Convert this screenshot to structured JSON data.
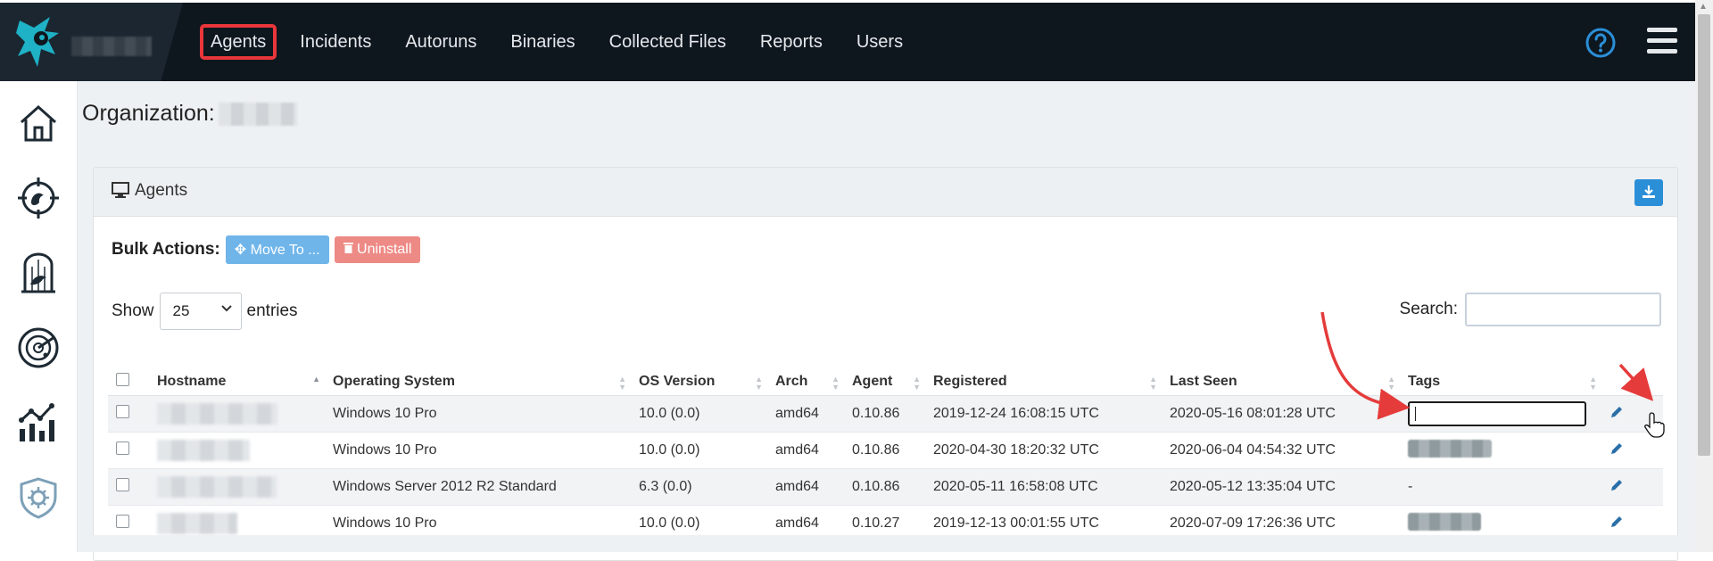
{
  "topbar": {
    "nav": [
      "Agents",
      "Incidents",
      "Autoruns",
      "Binaries",
      "Collected Files",
      "Reports",
      "Users"
    ],
    "active_nav": "Agents"
  },
  "sidebar": {
    "icons": [
      "home-icon",
      "threat-target-icon",
      "caged-bird-icon",
      "radar-icon",
      "stats-chart-icon",
      "shield-gear-icon"
    ]
  },
  "page": {
    "org_label": "Organization:"
  },
  "panel": {
    "title": "Agents",
    "bulk_label": "Bulk Actions:",
    "move_to_label": "Move To ...",
    "uninstall_label": "Uninstall",
    "show_label": "Show",
    "entries_value": "25",
    "entries_label": "entries",
    "search_label": "Search:",
    "search_value": ""
  },
  "table": {
    "columns": [
      "Hostname",
      "Operating System",
      "OS Version",
      "Arch",
      "Agent",
      "Registered",
      "Last Seen",
      "Tags"
    ],
    "rows": [
      {
        "os": "Windows 10 Pro",
        "os_version": "10.0 (0.0)",
        "arch": "amd64",
        "agent": "0.10.86",
        "registered": "2019-12-24 16:08:15 UTC",
        "last_seen": "2020-05-16 08:01:28 UTC",
        "tag": "editing"
      },
      {
        "os": "Windows 10 Pro",
        "os_version": "10.0 (0.0)",
        "arch": "amd64",
        "agent": "0.10.86",
        "registered": "2020-04-30 18:20:32 UTC",
        "last_seen": "2020-06-04 04:54:32 UTC",
        "tag": "tag"
      },
      {
        "os": "Windows Server 2012 R2 Standard",
        "os_version": "6.3 (0.0)",
        "arch": "amd64",
        "agent": "0.10.86",
        "registered": "2020-05-11 16:58:08 UTC",
        "last_seen": "2020-05-12 13:35:04 UTC",
        "tag": "-"
      },
      {
        "os": "Windows 10 Pro",
        "os_version": "10.0 (0.0)",
        "arch": "amd64",
        "agent": "0.10.27",
        "registered": "2019-12-13 00:01:55 UTC",
        "last_seen": "2020-07-09 17:26:36 UTC",
        "tag": "tag"
      }
    ]
  },
  "colors": {
    "topbar": "#0e161e",
    "accent": "#2b8fd8",
    "active_outline": "#e8363a",
    "annotation": "#e53b3b"
  }
}
